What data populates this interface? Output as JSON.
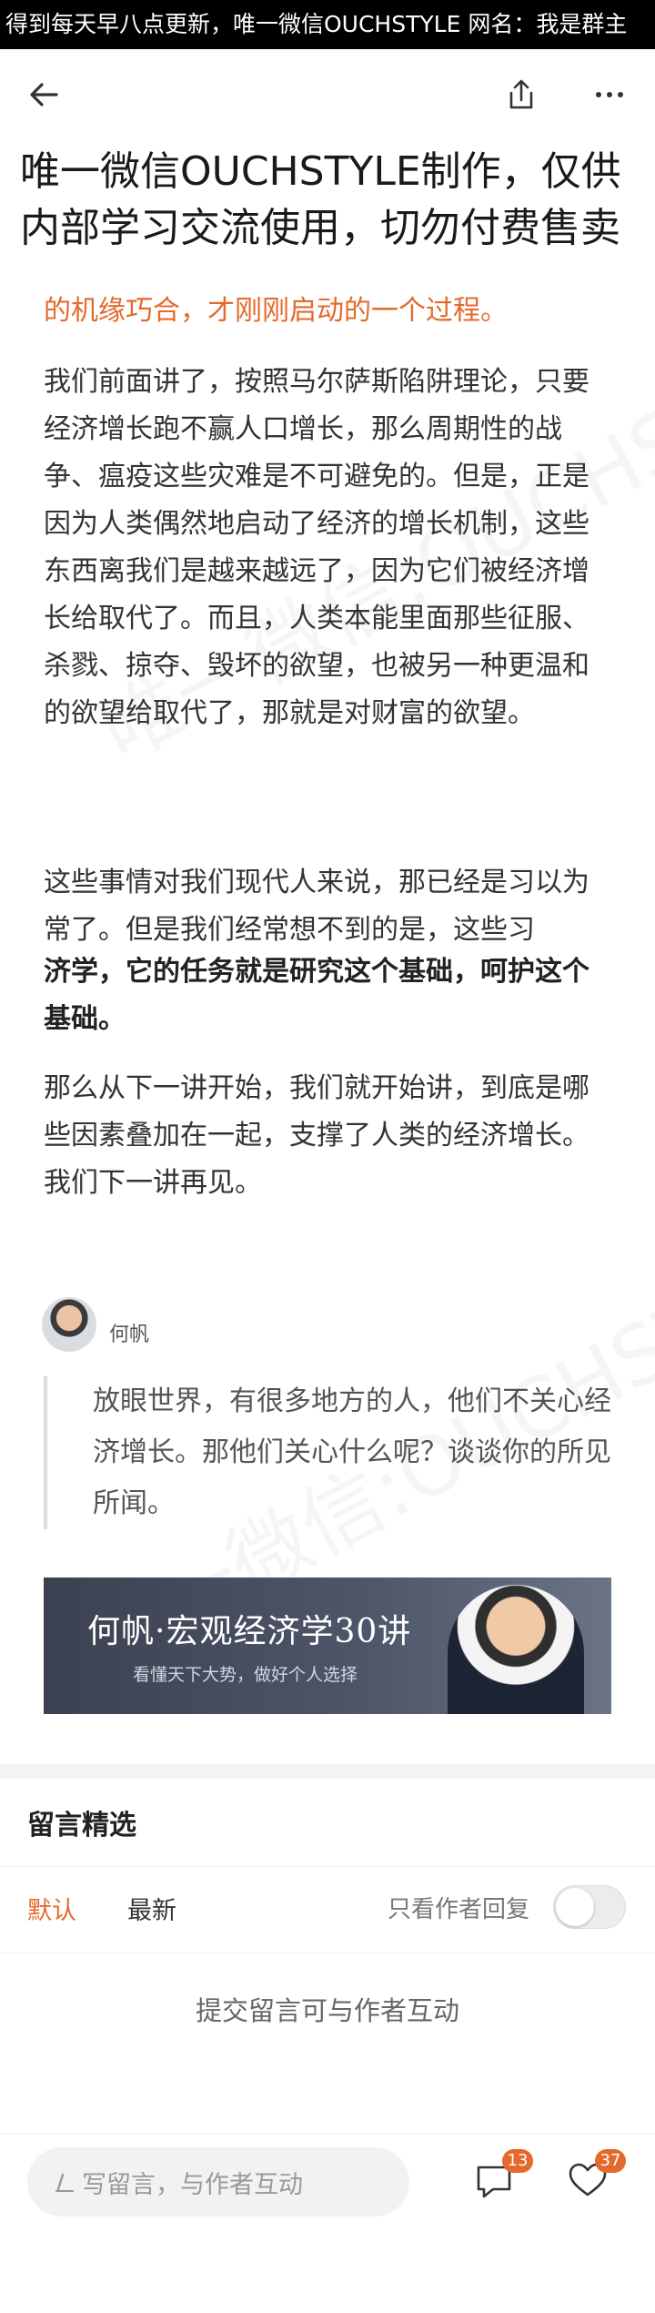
{
  "banner": {
    "text": "得到每天早八点更新，唯一微信OUCHSTYLE 网名：我是群主"
  },
  "topbar": {
    "back_icon": "arrow-left-icon",
    "share_icon": "share-icon",
    "more_icon": "more-icon"
  },
  "title": "唯一微信OUCHSTYLE制作，仅供内部学习交流使用，切勿付费售卖",
  "article": {
    "lead": "的机缘巧合，才刚刚启动的一个过程。",
    "p1": "我们前面讲了，按照马尔萨斯陷阱理论，只要经济增长跑不赢人口增长，那么周期性的战争、瘟疫这些灾难是不可避免的。但是，正是因为人类偶然地启动了经济的增长机制，这些东西离我们是越来越远了，因为它们被经济增长给取代了。而且，人类本能里面那些征服、杀戮、掠夺、毁坏的欲望，也被另一种更温和的欲望给取代了，那就是对财富的欲望。",
    "p2a": "这些事情对我们现代人来说，那已经是习以为常了。但是我们经常想不到的是，这些习",
    "p2b": "济学，它的任务就是研究这个基础，呵护这个基础。",
    "p3": "那么从下一讲开始，我们就开始讲，到底是哪些因素叠加在一起，支撑了人类的经济增长。我们下一讲再见。"
  },
  "author": {
    "name": "何帆"
  },
  "quote": "放眼世界，有很多地方的人，他们不关心经济增长。那他们关心什么呢？谈谈你的所见所闻。",
  "promo": {
    "title": "何帆·宏观经济学30讲",
    "subtitle": "看懂天下大势，做好个人选择"
  },
  "comments": {
    "section_title": "留言精选",
    "tab_default": "默认",
    "tab_latest": "最新",
    "only_author": "只看作者回复",
    "only_author_on": false,
    "empty_hint": "提交留言可与作者互动"
  },
  "bottom": {
    "input_placeholder": "写留言，与作者互动",
    "comment_count": "13",
    "like_count": "37"
  },
  "colors": {
    "accent": "#e5692a",
    "banner_bg": "#000000"
  }
}
